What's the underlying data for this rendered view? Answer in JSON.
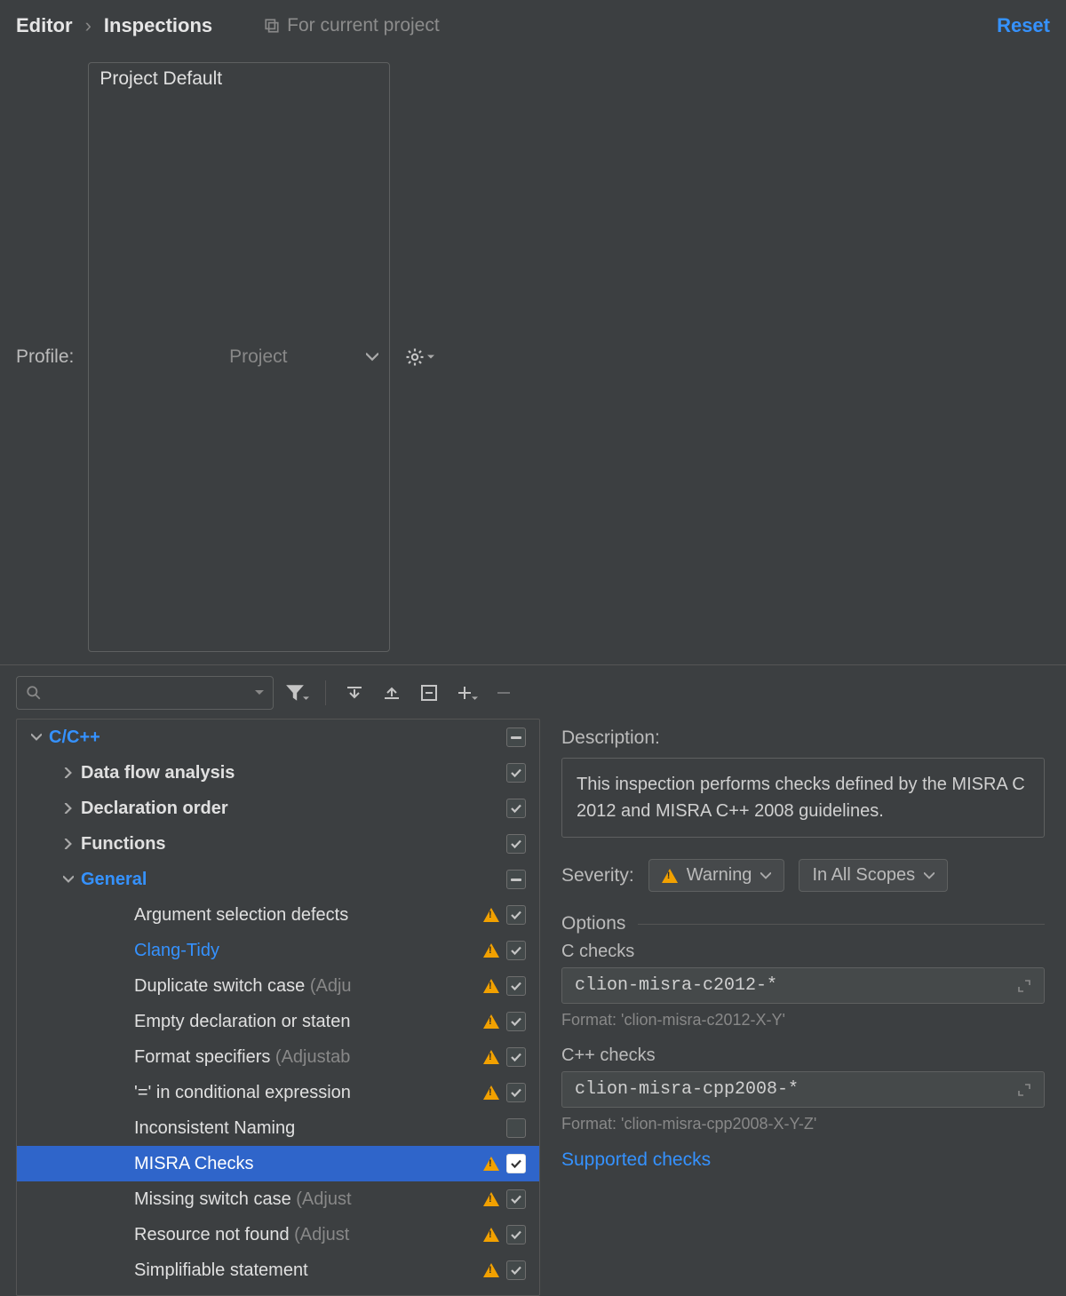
{
  "breadcrumb": {
    "parent": "Editor",
    "current": "Inspections"
  },
  "for_current_project": "For current project",
  "reset": "Reset",
  "profile": {
    "label": "Profile:",
    "value": "Project Default",
    "scope_hint": "Project"
  },
  "tree": {
    "root": "C/C++",
    "groups": [
      {
        "label": "Data flow analysis",
        "expanded": false,
        "state": "checked"
      },
      {
        "label": "Declaration order",
        "expanded": false,
        "state": "checked"
      },
      {
        "label": "Functions",
        "expanded": false,
        "state": "checked"
      },
      {
        "label": "General",
        "expanded": true,
        "state": "indeterminate"
      }
    ],
    "general_items": [
      {
        "label": "Argument selection defects",
        "hint": "",
        "warn": true,
        "checked": true,
        "selected": false,
        "link": false
      },
      {
        "label": "Clang-Tidy",
        "hint": "",
        "warn": true,
        "checked": true,
        "selected": false,
        "link": true
      },
      {
        "label": "Duplicate switch case",
        "hint": " (Adju",
        "warn": true,
        "checked": true,
        "selected": false,
        "link": false
      },
      {
        "label": "Empty declaration or staten",
        "hint": "",
        "warn": true,
        "checked": true,
        "selected": false,
        "link": false
      },
      {
        "label": "Format specifiers",
        "hint": " (Adjustab",
        "warn": true,
        "checked": true,
        "selected": false,
        "link": false
      },
      {
        "label": "'=' in conditional expression",
        "hint": "",
        "warn": true,
        "checked": true,
        "selected": false,
        "link": false
      },
      {
        "label": "Inconsistent Naming",
        "hint": "",
        "warn": false,
        "checked": false,
        "selected": false,
        "link": false
      },
      {
        "label": "MISRA Checks",
        "hint": "",
        "warn": true,
        "checked": true,
        "selected": true,
        "link": false
      },
      {
        "label": "Missing switch case",
        "hint": " (Adjust",
        "warn": true,
        "checked": true,
        "selected": false,
        "link": false
      },
      {
        "label": "Resource not found",
        "hint": " (Adjust",
        "warn": true,
        "checked": true,
        "selected": false,
        "link": false
      },
      {
        "label": "Simplifiable statement",
        "hint": "",
        "warn": true,
        "checked": true,
        "selected": false,
        "link": false
      }
    ]
  },
  "detail": {
    "description_label": "Description:",
    "description_text": "This inspection performs checks defined by the MISRA C 2012 and MISRA C++ 2008 guidelines.",
    "severity_label": "Severity:",
    "severity_value": "Warning",
    "scope_value": "In All Scopes",
    "options_label": "Options",
    "c_checks_label": "C checks",
    "c_checks_value": "clion-misra-c2012-*",
    "c_checks_format": "Format: 'clion-misra-c2012-X-Y'",
    "cpp_checks_label": "C++ checks",
    "cpp_checks_value": "clion-misra-cpp2008-*",
    "cpp_checks_format": "Format: 'clion-misra-cpp2008-X-Y-Z'",
    "supported_link": "Supported checks"
  }
}
